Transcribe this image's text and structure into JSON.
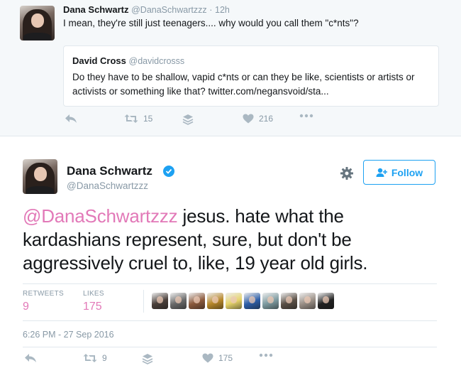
{
  "reply_tweet": {
    "author_name": "Dana Schwartz",
    "author_handle": "@DanaSchwartzzz",
    "time": "12h",
    "separator": "·",
    "text": "I mean, they're still just teenagers.... why would you call them \"c*nts\"?",
    "quoted": {
      "author_name": "David Cross",
      "author_handle": "@davidcrosss",
      "text": "Do they have to be shallow, vapid c*nts or can they be like, scientists or artists or activists or something like that? twitter.com/negansvoid/sta..."
    },
    "actions": {
      "retweets": "15",
      "likes": "216"
    }
  },
  "main_tweet": {
    "author_name": "Dana Schwartz",
    "author_handle": "@DanaSchwartzzz",
    "follow_label": "Follow",
    "mention": "@DanaSchwartzzz",
    "text": " jesus. hate what the kardashians represent, sure, but don't be aggressively cruel to, like, 19 year old girls.",
    "stats": {
      "retweets_label": "RETWEETS",
      "retweets_count": "9",
      "likes_label": "LIKES",
      "likes_count": "175"
    },
    "timestamp": "6:26 PM - 27 Sep 2016",
    "actions": {
      "retweets": "9",
      "likes": "175"
    }
  },
  "colors": {
    "link_pink": "#e279b8",
    "twitter_blue": "#1da1f2",
    "muted_gray": "#8899a6",
    "icon_gray": "#aab8c2",
    "top_background": "#f5f8fa"
  },
  "likers": [
    {
      "name": "liker-1",
      "color": "#4a3f3a"
    },
    {
      "name": "liker-2",
      "color": "#6a6a6a"
    },
    {
      "name": "liker-3",
      "color": "#8c5a3c"
    },
    {
      "name": "liker-4",
      "color": "#b8882a"
    },
    {
      "name": "liker-5",
      "color": "#e6d36a"
    },
    {
      "name": "liker-6",
      "color": "#2e5fa8"
    },
    {
      "name": "liker-7",
      "color": "#7d9aa0"
    },
    {
      "name": "liker-8",
      "color": "#5b5046"
    },
    {
      "name": "liker-9",
      "color": "#9a8f86"
    },
    {
      "name": "liker-10",
      "color": "#222222"
    }
  ]
}
